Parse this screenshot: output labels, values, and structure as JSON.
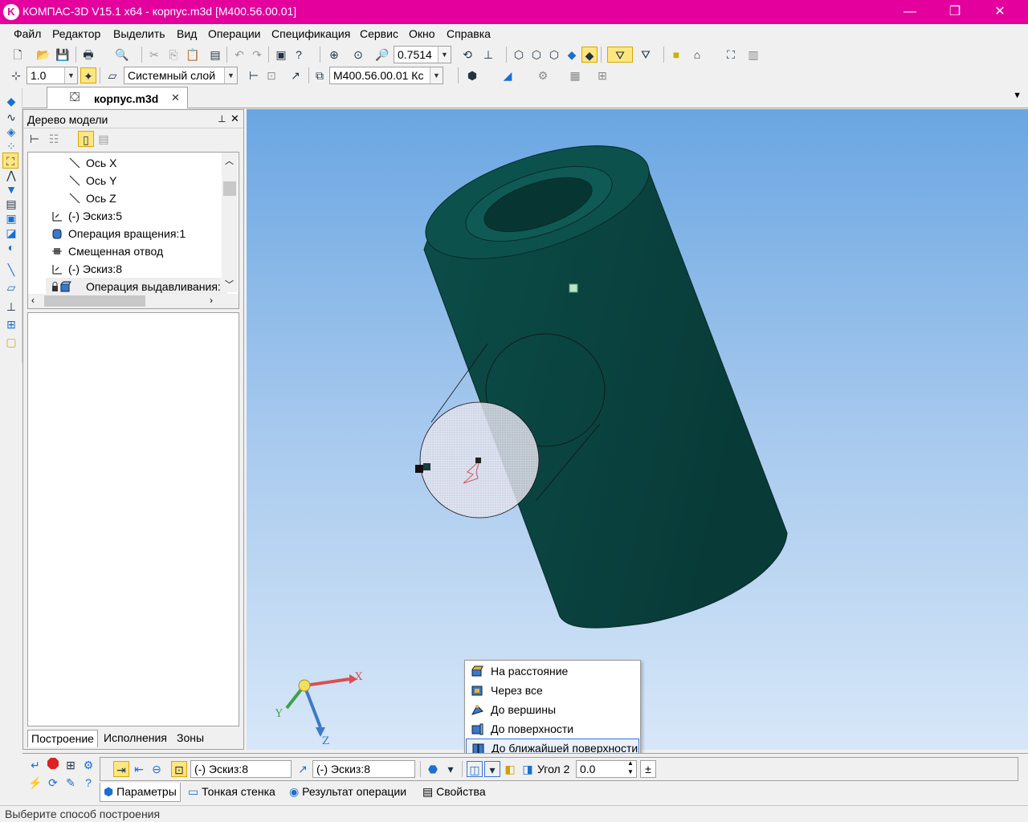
{
  "window": {
    "title": "КОМПАС-3D V15.1 x64 - корпус.m3d [M400.56.00.01]",
    "minimize_glyph": "—",
    "maximize_glyph": "❐",
    "close_glyph": "✕"
  },
  "menu": [
    "Файл",
    "Редактор",
    "Выделить",
    "Вид",
    "Операции",
    "Спецификация",
    "Сервис",
    "Окно",
    "Справка"
  ],
  "toolbar1": {
    "zoom_value": "0.7514"
  },
  "toolbar2": {
    "step_value": "1.0",
    "layer_value": "Системный слой",
    "designation_value": "M400.56.00.01 Кс"
  },
  "document_tab": {
    "label": "корпус.m3d",
    "close": "✕",
    "menu_arrow": "▼"
  },
  "model_tree": {
    "title": "Дерево модели",
    "pin": "⊥",
    "close": "✕",
    "items": [
      {
        "label": "Ось X"
      },
      {
        "label": "Ось Y"
      },
      {
        "label": "Ось Z"
      },
      {
        "label": "(-) Эскиз:5"
      },
      {
        "label": "Операция вращения:1"
      },
      {
        "label": "Смещенная отвод"
      },
      {
        "label": "(-) Эскиз:8"
      },
      {
        "label": "Операция выдавливания:"
      }
    ],
    "tabs": [
      "Построение",
      "Исполнения",
      "Зоны"
    ]
  },
  "axes": {
    "x": "X",
    "y": "Y",
    "z": "Z"
  },
  "extrude_dropdown": {
    "items": [
      {
        "label": "На расстояние",
        "icon": "distance-icon"
      },
      {
        "label": "Через все",
        "icon": "through-all-icon"
      },
      {
        "label": "До вершины",
        "icon": "to-vertex-icon"
      },
      {
        "label": "До поверхности",
        "icon": "to-surface-icon"
      },
      {
        "label": "До ближайшей поверхности",
        "icon": "to-nearest-surface-icon"
      }
    ],
    "selected_index": 4
  },
  "property_panel": {
    "sketch_field_1": "(-) Эскиз:8",
    "sketch_field_2": "(-) Эскиз:8",
    "angle_label": "Угол 2",
    "angle_value": "0.0",
    "plus_minus": "±",
    "tabs": [
      "Параметры",
      "Тонкая стенка",
      "Результат операции",
      "Свойства"
    ]
  },
  "status": {
    "text": "Выберите способ построения"
  },
  "colors": {
    "titlebar": "#e3009d",
    "model_body": "#0b4743",
    "viewport_top": "#6aa6e2",
    "viewport_bottom": "#d7e7f8"
  }
}
